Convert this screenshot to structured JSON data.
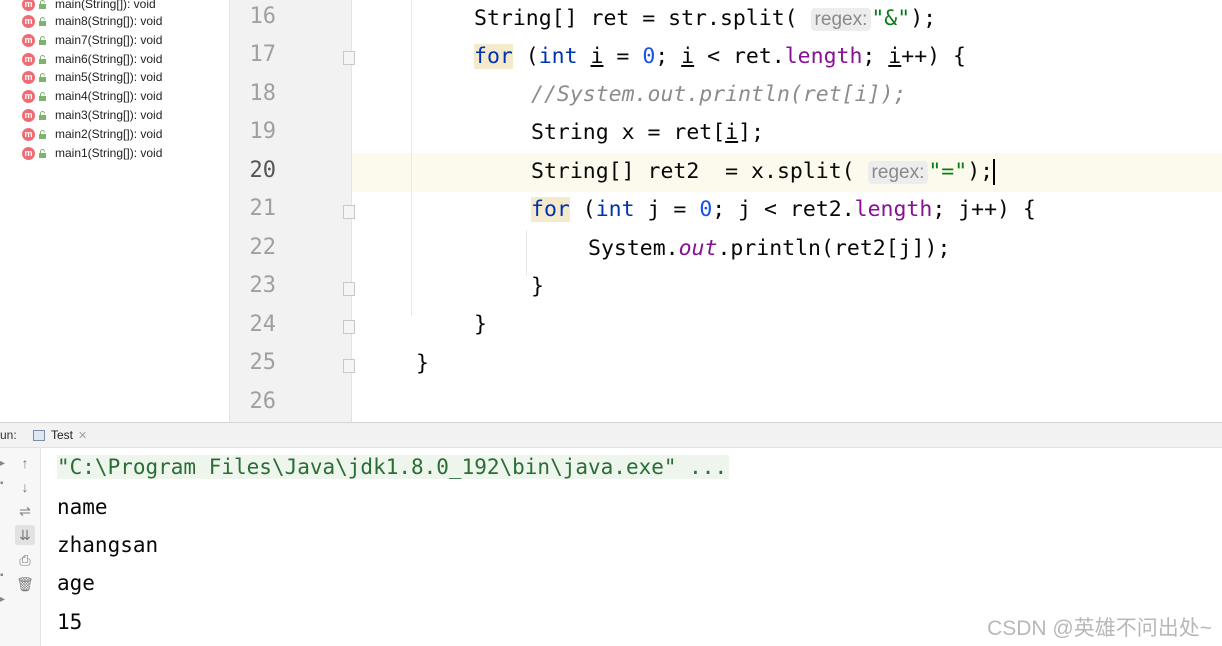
{
  "structure": {
    "items": [
      "main(String[]): void",
      "main8(String[]): void",
      "main7(String[]): void",
      "main6(String[]): void",
      "main5(String[]): void",
      "main4(String[]): void",
      "main3(String[]): void",
      "main2(String[]): void",
      "main1(String[]): void"
    ],
    "method_badge": "m"
  },
  "editor": {
    "line_numbers": [
      "16",
      "17",
      "18",
      "19",
      "20",
      "21",
      "22",
      "23",
      "24",
      "25",
      "26"
    ],
    "current_line": "20",
    "hints": {
      "regex": "regex:"
    },
    "strings": {
      "amp": "\"&\"",
      "eq": "\"=\""
    },
    "comment": "//System.out.println(ret[i]);"
  },
  "run": {
    "label": "un:",
    "tab": "Test",
    "output": [
      "\"C:\\Program Files\\Java\\jdk1.8.0_192\\bin\\java.exe\" ...",
      "name",
      "zhangsan",
      "age",
      "15"
    ]
  },
  "watermark": "CSDN @英雄不问出处~",
  "colors": {
    "keyword": "#0033b3",
    "string": "#067d17",
    "number": "#1750eb",
    "field": "#871094",
    "comment": "#8c8c8c",
    "method_icon": "#ee6d74"
  }
}
